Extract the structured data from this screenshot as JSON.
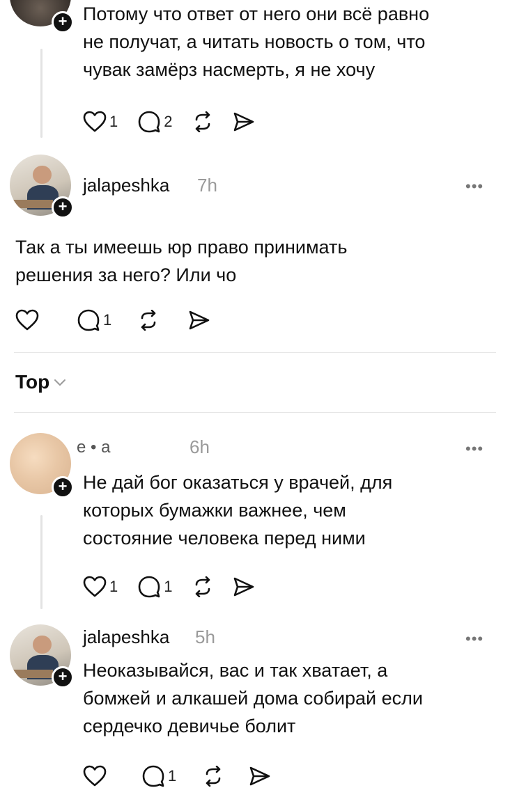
{
  "comments": [
    {
      "username": "",
      "time": "",
      "text_lines": [
        "Потому что ответ от него они всё равно",
        "не получат, а читать новость о том, что",
        "чувак замёрз насмерть, я не хочу"
      ],
      "likes": "1",
      "replies": "2"
    },
    {
      "username": "jalapeshka",
      "time": "7h",
      "text_lines": [
        "Так а ты имеешь юр право принимать",
        "решения за него? Или чо"
      ],
      "likes": "",
      "replies": "1"
    },
    {
      "username": "е • а",
      "time": "6h",
      "text_lines": [
        "Не дай бог оказаться у врачей, для",
        "которых бумажки важнее, чем",
        "состояние человека перед ними"
      ],
      "likes": "1",
      "replies": "1"
    },
    {
      "username": "jalapeshka",
      "time": "5h",
      "text_lines": [
        "Неоказывайся, вас и так хватает, а",
        "бомжей и алкашей дома собирай если",
        "сердечко девичье болит"
      ],
      "likes": "",
      "replies": "1"
    }
  ],
  "sort": {
    "label": "Top"
  },
  "icons": {
    "like": "heart-icon",
    "reply": "comment-icon",
    "repost": "repost-icon",
    "share": "send-icon",
    "follow": "plus-icon",
    "more": "more-icon",
    "chevron": "chevron-down-icon"
  },
  "more_label": "•••"
}
